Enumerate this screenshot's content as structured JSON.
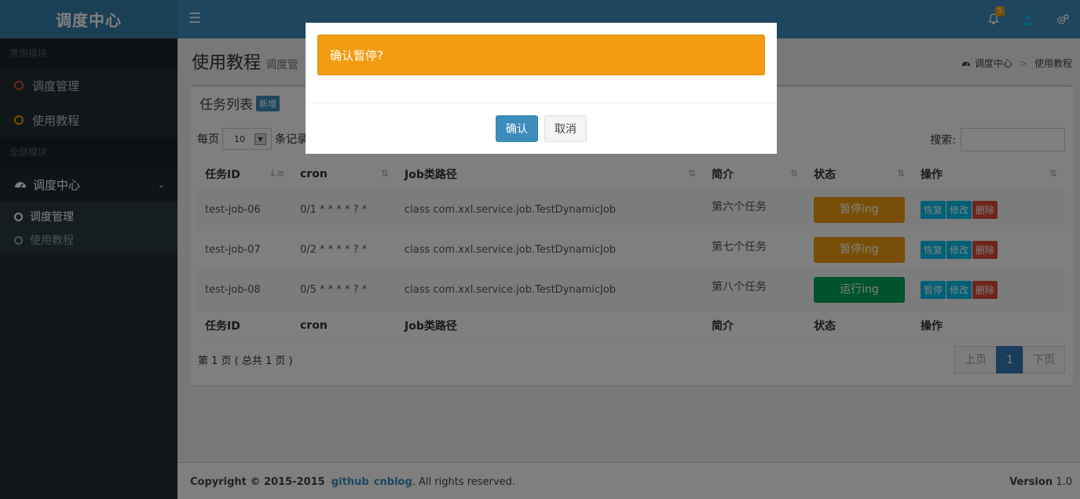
{
  "header": {
    "logo": "调度中心",
    "notification_count": "5"
  },
  "sidebar": {
    "section_common": "常用模块",
    "common_items": [
      {
        "label": "调度管理"
      },
      {
        "label": "使用教程"
      }
    ],
    "section_all": "全部模块",
    "group_label": "调度中心",
    "sub_items": [
      {
        "label": "调度管理"
      },
      {
        "label": "使用教程"
      }
    ]
  },
  "content": {
    "title": "使用教程",
    "subtitle": "调度管",
    "breadcrumb": [
      "调度中心",
      "使用教程"
    ],
    "box_title": "任务列表",
    "add_label": "新增",
    "length_prefix": "每页",
    "length_value": "10",
    "length_suffix": "条记录",
    "search_label": "搜索:",
    "search_value": ""
  },
  "table": {
    "columns": [
      "任务ID",
      "cron",
      "Job类路径",
      "简介",
      "状态",
      "操作"
    ],
    "rows": [
      {
        "id": "test-job-06",
        "cron": "0/1 * * * * ? *",
        "class": "class com.xxl.service.job.TestDynamicJob",
        "desc": "第六个任务",
        "status": "暂停ing",
        "status_type": "paused",
        "ops": [
          "恢复",
          "修改",
          "删除"
        ]
      },
      {
        "id": "test-job-07",
        "cron": "0/2 * * * * ? *",
        "class": "class com.xxl.service.job.TestDynamicJob",
        "desc": "第七个任务",
        "status": "暂停ing",
        "status_type": "paused",
        "ops": [
          "恢复",
          "修改",
          "删除"
        ]
      },
      {
        "id": "test-job-08",
        "cron": "0/5 * * * * ? *",
        "class": "class com.xxl.service.job.TestDynamicJob",
        "desc": "第八个任务",
        "status": "运行ing",
        "status_type": "running",
        "ops": [
          "暂停",
          "修改",
          "删除"
        ]
      }
    ],
    "info": "第 1 页 ( 总共 1 页 )",
    "pager": {
      "prev": "上页",
      "current": "1",
      "next": "下页"
    }
  },
  "footer": {
    "copyright": "Copyright © 2015-2015",
    "link1": "github",
    "link2": "cnblog",
    "rights": ". All rights reserved.",
    "version_label": "Version",
    "version": "1.0"
  },
  "modal": {
    "message": "确认暂停?",
    "confirm": "确认",
    "cancel": "取消"
  },
  "colors": {
    "brand": "#3c8dbc",
    "warning": "#f39c12",
    "success": "#00a65a",
    "danger": "#dd4b39",
    "info": "#00c0ef"
  }
}
